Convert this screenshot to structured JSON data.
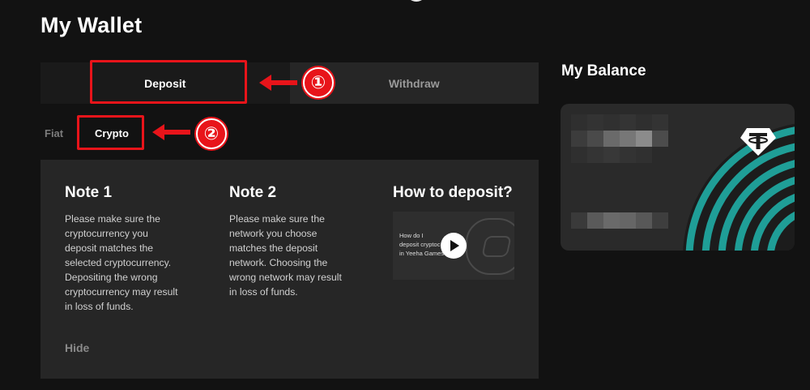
{
  "page": {
    "title": "My Wallet"
  },
  "tabs": {
    "deposit": "Deposit",
    "withdraw": "Withdraw"
  },
  "subtabs": {
    "fiat": "Fiat",
    "crypto": "Crypto"
  },
  "annotations": {
    "badge_1": "①",
    "badge_2": "②",
    "color": "#e8141a"
  },
  "notes": {
    "note1": {
      "title": "Note 1",
      "lines": [
        "Please make sure the",
        "cryptocurrency you",
        "deposit matches the",
        "selected cryptocurrency.",
        "Depositing the wrong",
        "cryptocurrency may result",
        "in loss of funds."
      ]
    },
    "note2": {
      "title": "Note 2",
      "lines": [
        "Please make sure the",
        "network you choose",
        "matches the deposit",
        "network. Choosing the",
        "wrong network may result",
        "in loss of funds."
      ]
    },
    "howto": {
      "title": "How to deposit?",
      "video_lines": [
        "How do I",
        "deposit cryptoc",
        "in Yeeha Games"
      ]
    },
    "hide_label": "Hide"
  },
  "balance": {
    "title": "My Balance",
    "accent": "#1fa9a1",
    "currency_icon": "tether-usdt-icon"
  }
}
